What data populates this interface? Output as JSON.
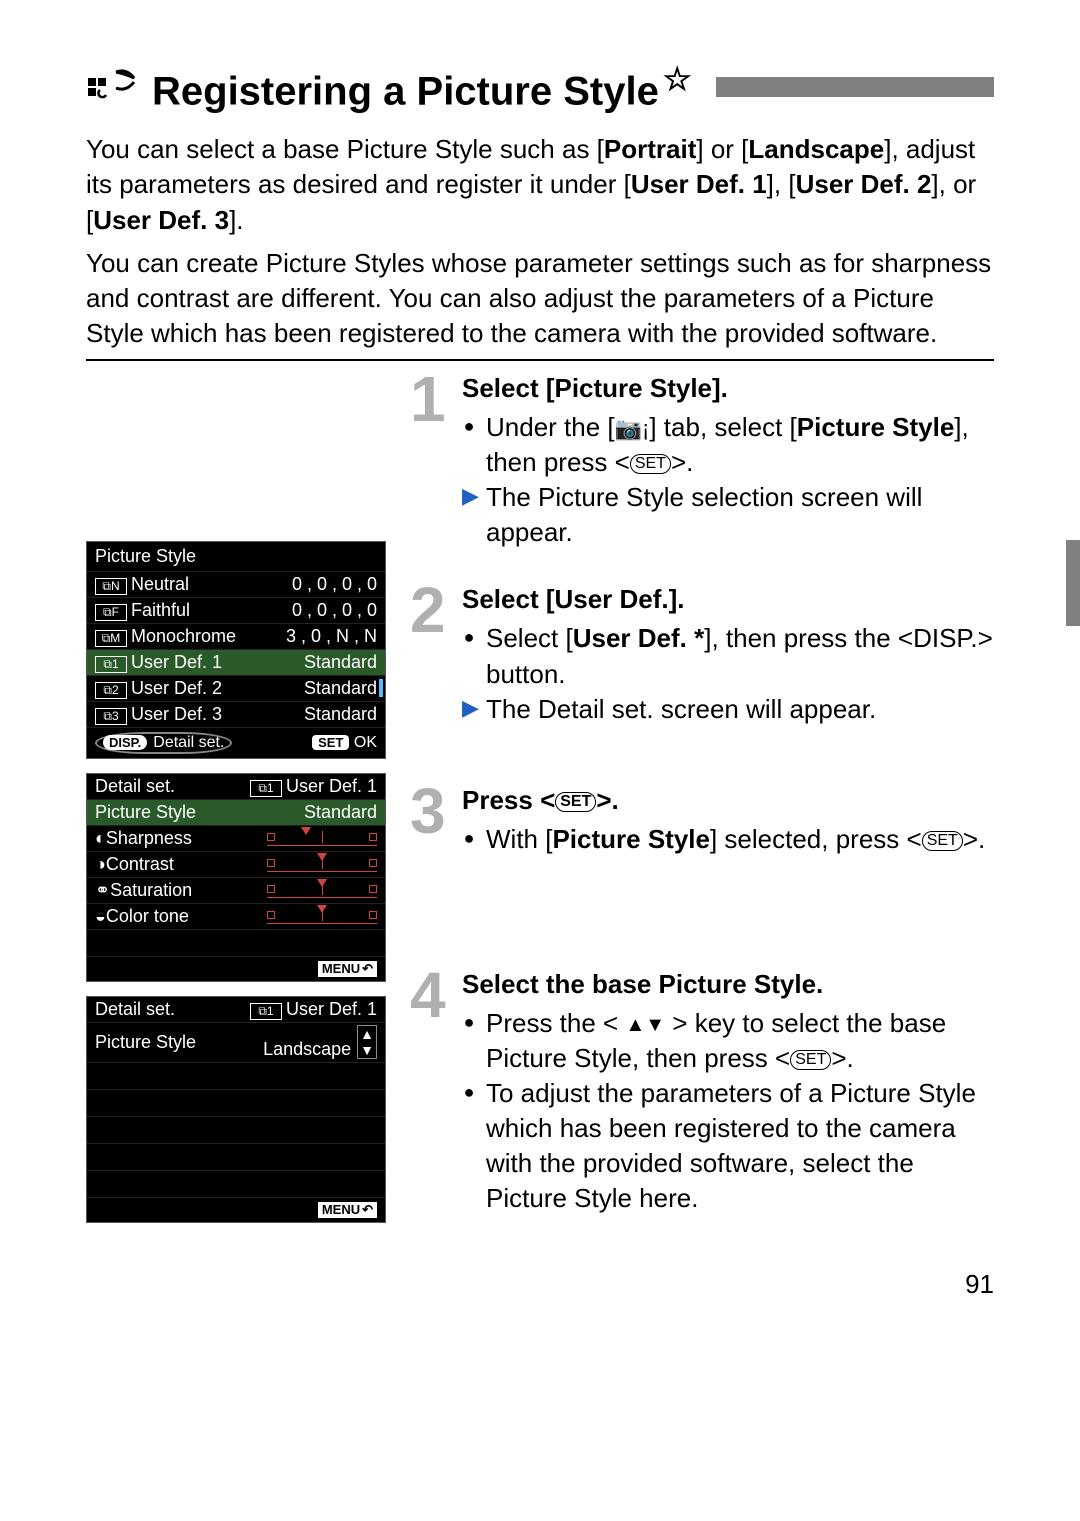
{
  "title": "Registering a Picture Style",
  "intro_parts": {
    "p1a": "You can select a base Picture Style such as [",
    "p1b": "Portrait",
    "p1c": "] or [",
    "p1d": "Landscape",
    "p1e": "], adjust its parameters as desired and register it under [",
    "p1f": "User Def. 1",
    "p1g": "], [",
    "p1h": "User Def. 2",
    "p1i": "], or [",
    "p1j": "User Def. 3",
    "p1k": "]."
  },
  "intro2": "You can create Picture Styles whose parameter settings such as for sharpness and contrast are different. You can also adjust the parameters of a Picture Style which has been registered to the camera with the provided software.",
  "lcd1": {
    "title": "Picture Style",
    "rows": [
      {
        "icon": "⧉N",
        "name": "Neutral",
        "val": "0 , 0 , 0 , 0"
      },
      {
        "icon": "⧉F",
        "name": "Faithful",
        "val": "0 , 0 , 0 , 0"
      },
      {
        "icon": "⧉M",
        "name": "Monochrome",
        "val": "3 , 0 , N , N"
      },
      {
        "icon": "⧉1",
        "name": "User Def. 1",
        "val": "Standard"
      },
      {
        "icon": "⧉2",
        "name": "User Def. 2",
        "val": "Standard"
      },
      {
        "icon": "⧉3",
        "name": "User Def. 3",
        "val": "Standard"
      }
    ],
    "footer_left_btn": "DISP.",
    "footer_left_txt": "Detail set.",
    "footer_right_btn": "SET",
    "footer_right_txt": "OK"
  },
  "lcd2": {
    "h_left": "Detail set.",
    "h_right_icon": "⧉1",
    "h_right": "User Def. 1",
    "ps_label": "Picture Style",
    "ps_value": "Standard",
    "params": [
      {
        "icon": "◐",
        "name": "Sharpness"
      },
      {
        "icon": "◑",
        "name": "Contrast"
      },
      {
        "icon": "⚭",
        "name": "Saturation"
      },
      {
        "icon": "◒",
        "name": "Color tone"
      }
    ],
    "menu": "MENU"
  },
  "lcd3": {
    "h_left": "Detail set.",
    "h_right_icon": "⧉1",
    "h_right": "User Def. 1",
    "ps_label": "Picture Style",
    "ps_value": "Landscape",
    "menu": "MENU"
  },
  "steps": {
    "s1": {
      "num": "1",
      "title": "Select [Picture Style].",
      "b1a": "Under the [",
      "b1b": "] tab, select [",
      "b1c": "Picture Style",
      "b1d": "], then press <",
      "b1e": ">.",
      "b2": "The Picture Style selection screen will appear."
    },
    "s2": {
      "num": "2",
      "title": "Select [User Def.].",
      "b1a": "Select [",
      "b1b": "User Def. *",
      "b1c": "], then press the <",
      "b1d": "> button.",
      "disp": "DISP.",
      "b2": "The Detail set. screen will appear."
    },
    "s3": {
      "num": "3",
      "titlea": "Press <",
      "titleb": ">.",
      "b1a": "With [",
      "b1b": "Picture Style",
      "b1c": "] selected, press <",
      "b1d": ">."
    },
    "s4": {
      "num": "4",
      "title": "Select the base Picture Style.",
      "b1a": "Press the < ",
      "b1b": " > key to select the base Picture Style, then press <",
      "b1c": ">.",
      "b2": "To adjust the parameters of a Picture Style which has been registered to the camera with the provided software, select the Picture Style here."
    }
  },
  "set_label": "SET",
  "page_number": "91"
}
